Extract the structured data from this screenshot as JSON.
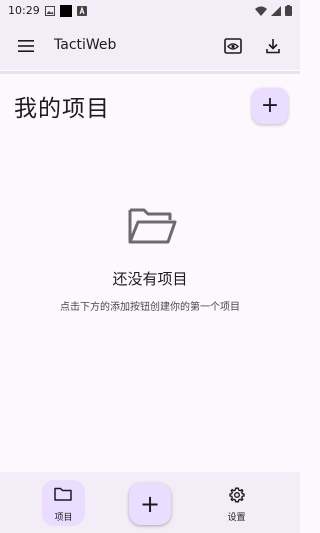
{
  "status_bar": {
    "time": "10:29",
    "icons_left": [
      "image-icon",
      "black-square-icon",
      "font-icon"
    ],
    "icons_right": [
      "wifi-icon",
      "signal-icon",
      "battery-icon"
    ]
  },
  "app_bar": {
    "title": "TactiWeb",
    "menu_icon": "menu-icon",
    "actions": [
      "preview-icon",
      "download-icon"
    ]
  },
  "main": {
    "page_title": "我的项目",
    "add_button_label": "+",
    "empty_state": {
      "icon": "folder-open-icon",
      "title": "还没有项目",
      "subtitle": "点击下方的添加按钮创建你的第一个项目"
    }
  },
  "bottom_nav": {
    "projects_label": "项目",
    "add_label": "+",
    "settings_label": "设置",
    "active": "projects"
  },
  "colors": {
    "background": "#fdf8fd",
    "app_bar": "#f3edf7",
    "accent_container": "#eaddff",
    "text_primary": "#1c1b1f",
    "text_secondary": "#49454f"
  }
}
